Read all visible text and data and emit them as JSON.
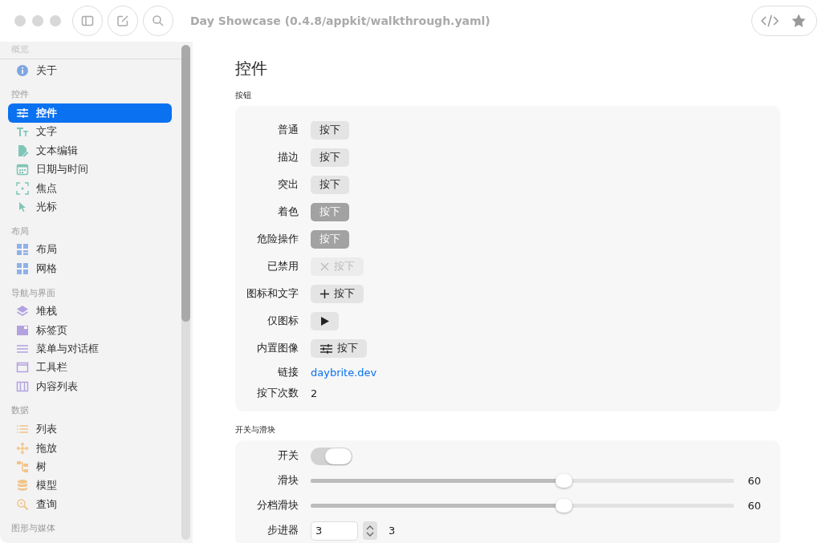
{
  "window": {
    "title": "Day Showcase (0.4.8/appkit/walkthrough.yaml)"
  },
  "sidebar": {
    "sections": [
      {
        "title": "概览",
        "items": [
          {
            "label": "关于",
            "selected": false
          }
        ]
      },
      {
        "title": "控件",
        "items": [
          {
            "label": "控件",
            "selected": true
          },
          {
            "label": "文字",
            "selected": false
          },
          {
            "label": "文本编辑",
            "selected": false
          },
          {
            "label": "日期与时间",
            "selected": false
          },
          {
            "label": "焦点",
            "selected": false
          },
          {
            "label": "光标",
            "selected": false
          }
        ]
      },
      {
        "title": "布局",
        "items": [
          {
            "label": "布局",
            "selected": false
          },
          {
            "label": "网格",
            "selected": false
          }
        ]
      },
      {
        "title": "导航与界面",
        "items": [
          {
            "label": "堆栈",
            "selected": false
          },
          {
            "label": "标签页",
            "selected": false
          },
          {
            "label": "菜单与对话框",
            "selected": false
          },
          {
            "label": "工具栏",
            "selected": false
          },
          {
            "label": "内容列表",
            "selected": false
          }
        ]
      },
      {
        "title": "数据",
        "items": [
          {
            "label": "列表",
            "selected": false
          },
          {
            "label": "拖放",
            "selected": false
          },
          {
            "label": "树",
            "selected": false
          },
          {
            "label": "模型",
            "selected": false
          },
          {
            "label": "查询",
            "selected": false
          }
        ]
      },
      {
        "title": "图形与媒体"
      }
    ]
  },
  "page": {
    "title": "控件",
    "buttons_section": {
      "title": "按钮",
      "rows": [
        {
          "label": "普通",
          "kind": "plain",
          "text": "按下",
          "disabled": false
        },
        {
          "label": "描边",
          "kind": "plain",
          "text": "按下",
          "disabled": false
        },
        {
          "label": "突出",
          "kind": "plain",
          "text": "按下",
          "disabled": false
        },
        {
          "label": "着色",
          "kind": "tinted",
          "text": "按下",
          "disabled": false
        },
        {
          "label": "危险操作",
          "kind": "tinted",
          "text": "按下",
          "disabled": false
        },
        {
          "label": "已禁用",
          "kind": "x_icon",
          "text": "按下",
          "disabled": true
        },
        {
          "label": "图标和文字",
          "kind": "plus_icon",
          "text": "按下",
          "disabled": false
        },
        {
          "label": "仅图标",
          "kind": "play_icon",
          "disabled": false
        },
        {
          "label": "内置图像",
          "kind": "sliders_icon",
          "text": "按下",
          "disabled": false
        },
        {
          "label": "链接",
          "kind": "link",
          "text": "daybrite.dev"
        },
        {
          "label": "按下次数",
          "kind": "value",
          "text": "2"
        }
      ]
    },
    "switches_section": {
      "title": "开关与滑块",
      "rows": [
        {
          "label": "开关",
          "kind": "switch",
          "on": true
        },
        {
          "label": "滑块",
          "kind": "slider",
          "level": 0.6,
          "reading": "60"
        },
        {
          "label": "分档滑块",
          "kind": "slider",
          "level": 0.6,
          "reading": "60"
        },
        {
          "label": "步进器",
          "kind": "stepper",
          "value": "3",
          "reading": "3"
        }
      ]
    }
  }
}
